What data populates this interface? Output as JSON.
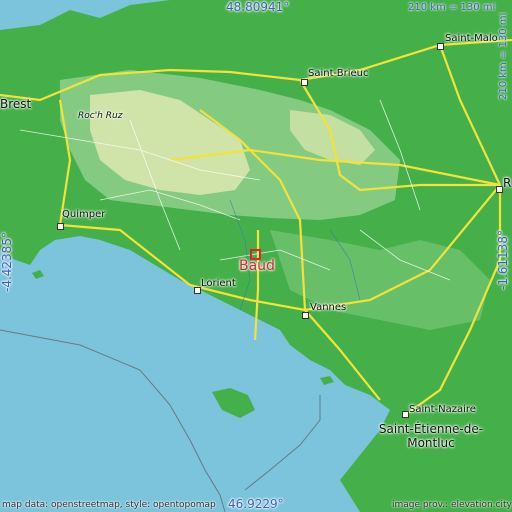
{
  "map": {
    "coords": {
      "top": "48.80941°",
      "bottom": "46.9229°",
      "left": "-4.42385°",
      "right": "-1.61138°"
    },
    "scale": {
      "top": "210 km = 130 mi",
      "right": "210 km = 130 mi"
    },
    "place_name": "Baud",
    "cities": [
      {
        "name": "Saint-Malo"
      },
      {
        "name": "Saint-Brieuc"
      },
      {
        "name": "Brest"
      },
      {
        "name": "Roc'h Ruz"
      },
      {
        "name": "Quimper"
      },
      {
        "name": "Lorient"
      },
      {
        "name": "Vannes"
      },
      {
        "name": "Saint-Nazaire"
      },
      {
        "name": "Saint-Étienne-de-Montluc"
      },
      {
        "name": "R"
      }
    ],
    "footer": {
      "left": "map data: openstreetmap, style: opentopomap",
      "right": "image prov.: elevation.city"
    },
    "colors": {
      "sea": "#7cc3dc",
      "lowland": "#3fae45",
      "midland": "#8ed08a",
      "upland": "#d7e7ae",
      "road_major": "#f2e23a",
      "marker": "#d9262e"
    }
  }
}
